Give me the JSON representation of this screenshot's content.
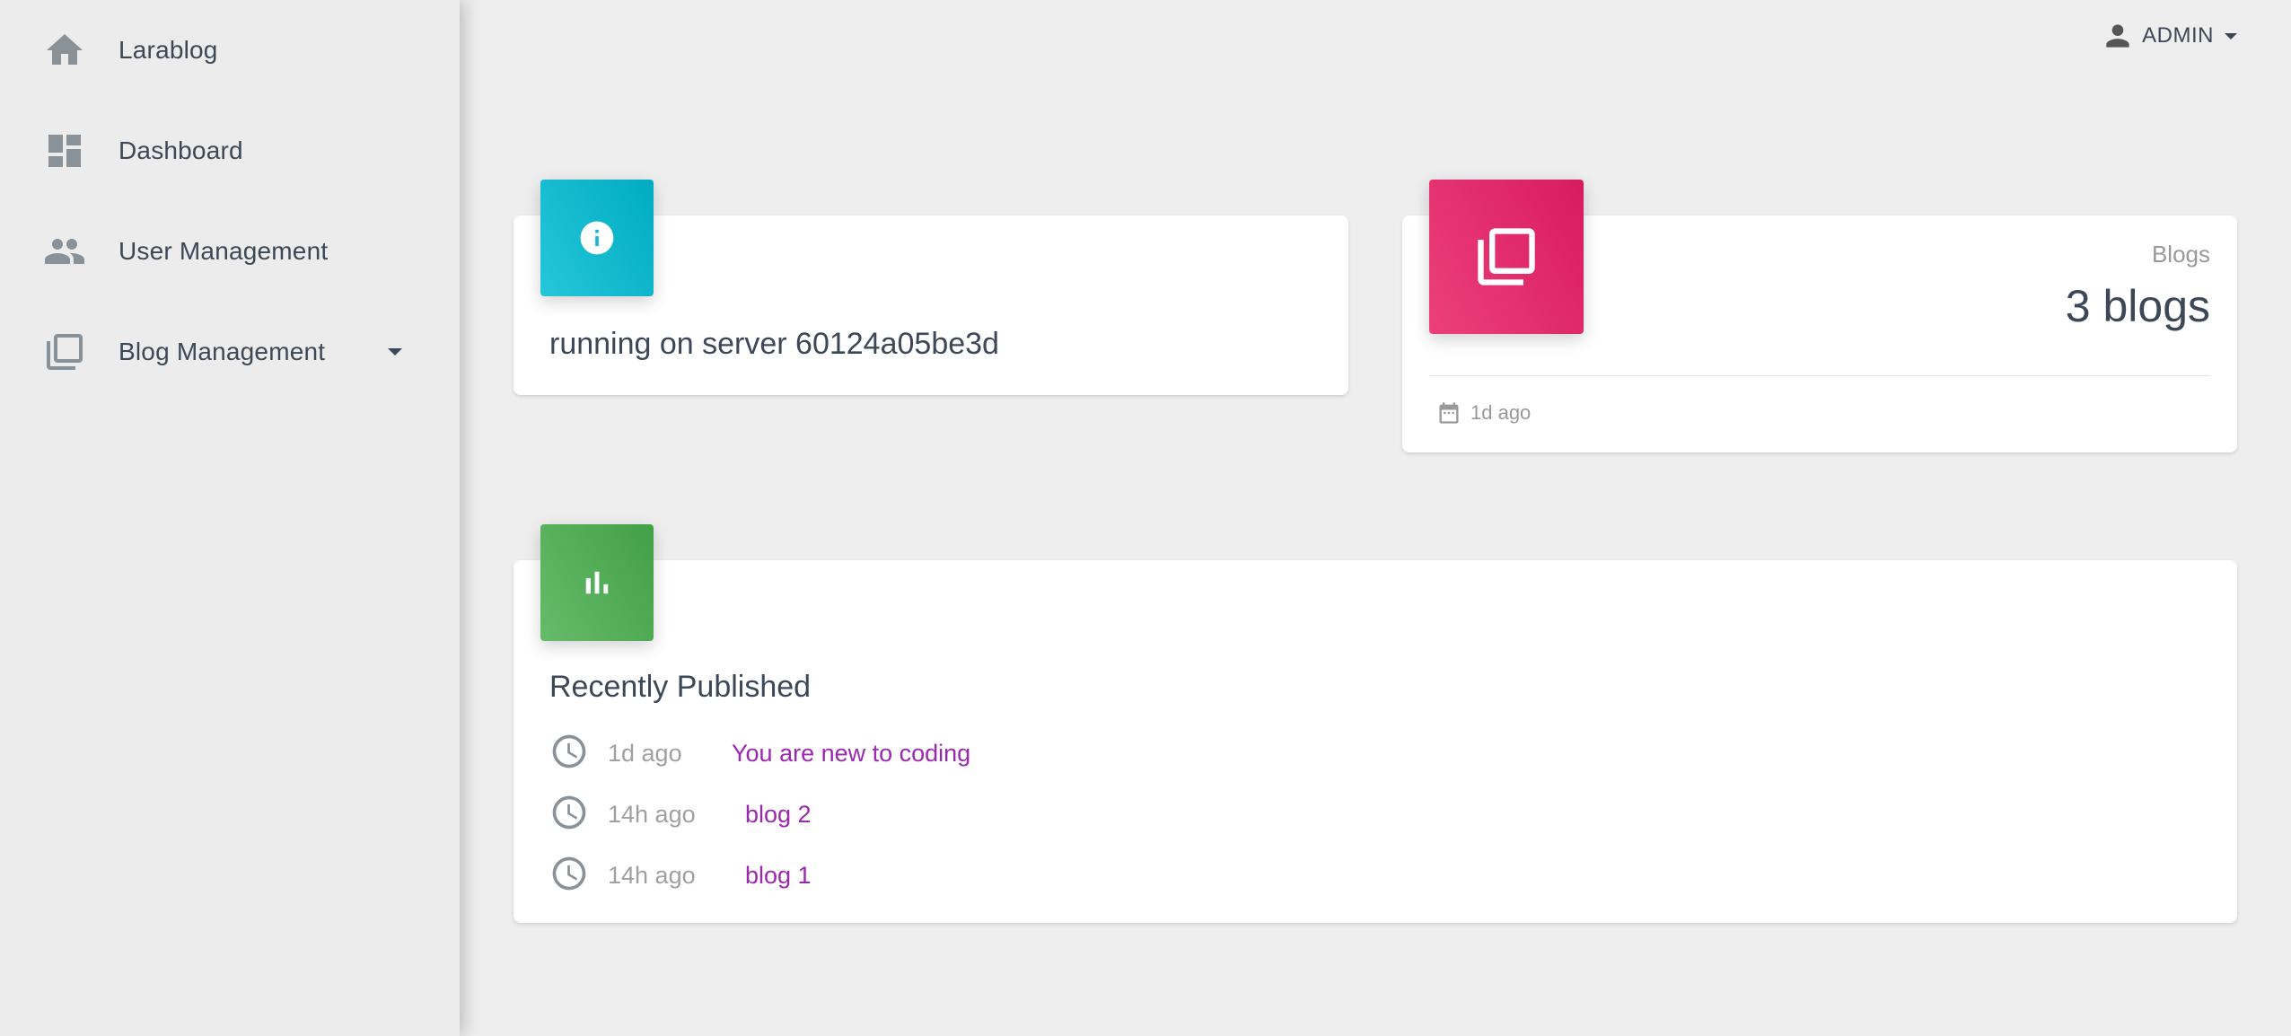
{
  "sidebar": {
    "items": [
      {
        "label": "Larablog",
        "icon": "home-icon"
      },
      {
        "label": "Dashboard",
        "icon": "dashboard-icon"
      },
      {
        "label": "User Management",
        "icon": "people-icon"
      },
      {
        "label": "Blog Management",
        "icon": "library-icon"
      }
    ]
  },
  "header": {
    "user_label": "ADMIN"
  },
  "server_card": {
    "text": "running on server 60124a05be3d"
  },
  "blogs_card": {
    "category": "Blogs",
    "value": "3 blogs",
    "footer": "1d ago"
  },
  "recent_card": {
    "title": "Recently Published",
    "rows": [
      {
        "time": "1d ago",
        "title": "You are new to coding"
      },
      {
        "time": "14h ago",
        "title": "blog 2"
      },
      {
        "time": "14h ago",
        "title": "blog 1"
      }
    ]
  },
  "colors": {
    "info": "#00bcd4",
    "blogs": "#e91e63",
    "chart": "#4caf50",
    "link": "#9c27b0"
  }
}
